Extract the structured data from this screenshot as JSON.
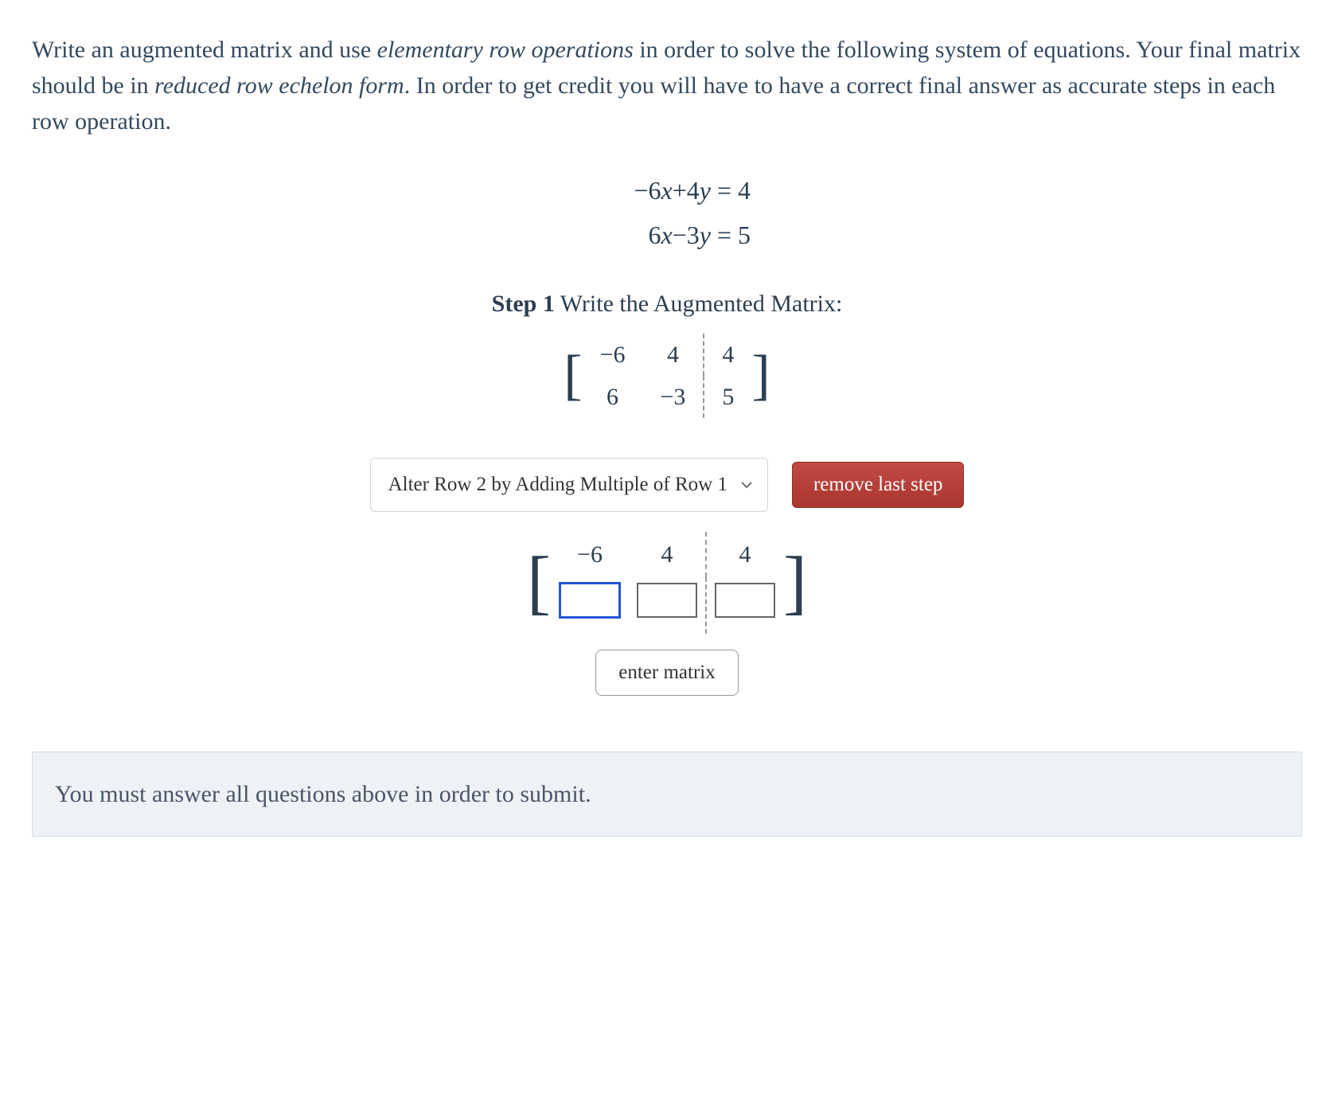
{
  "problem": {
    "text_pre": "Write an augmented matrix and use ",
    "em1": "elementary row operations",
    "text_mid": " in order to solve the following system of equations. Your final matrix should be in ",
    "em2": "reduced row echelon form",
    "text_post": ". In order to get credit you will have to have a correct final answer as accurate steps in each row operation."
  },
  "equations": {
    "line1_lhs": "−6x+4y",
    "line1_rhs": "= 4",
    "line2_lhs": "6x−3y",
    "line2_rhs": "= 5"
  },
  "step1": {
    "label": "Step 1",
    "rest": " Write the Augmented Matrix:",
    "matrix": {
      "r1c1": "−6",
      "r1c2": "4",
      "r1c3": "4",
      "r2c1": "6",
      "r2c2": "−3",
      "r2c3": "5"
    }
  },
  "controls": {
    "select_value": "Alter Row 2 by Adding Multiple of Row 1",
    "remove_label": "remove last step"
  },
  "input_matrix": {
    "r1c1": "−6",
    "r1c2": "4",
    "r1c3": "4",
    "r2c1": "",
    "r2c2": "",
    "r2c3": ""
  },
  "enter_label": "enter matrix",
  "notice": "You must answer all questions above in order to submit.",
  "colors": {
    "primary_text": "#2c3e50",
    "danger_btn": "#b43d3b",
    "notice_bg": "#eef1f5",
    "focus_blue": "#2456d6"
  }
}
